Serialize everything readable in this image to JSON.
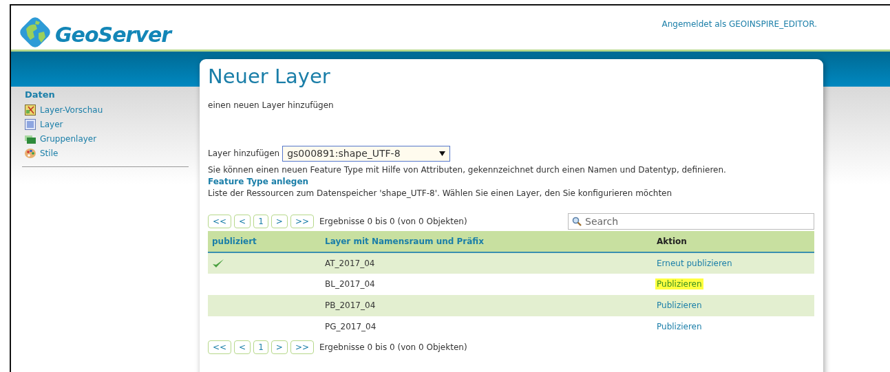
{
  "header": {
    "logo_text": "GeoServer",
    "login_text": "Angemeldet als GEOINSPIRE_EDITOR."
  },
  "sidebar": {
    "heading": "Daten",
    "items": [
      {
        "label": "Layer-Vorschau",
        "kind": "preview"
      },
      {
        "label": "Layer",
        "kind": "layer"
      },
      {
        "label": "Gruppenlayer",
        "kind": "group"
      },
      {
        "label": "Stile",
        "kind": "style"
      }
    ]
  },
  "page": {
    "title": "Neuer Layer",
    "subtitle": "einen neuen Layer hinzufügen",
    "select_label": "Layer hinzufügen",
    "select_value": "gs000891:shape_UTF-8",
    "description": "Sie können einen neuen Feature Type mit Hilfe von Attributen, gekennzeichnet durch einen Namen und Datentyp, definieren.",
    "description_link": "Feature Type anlegen",
    "resources_text": "Liste der Ressourcen zum Datenspeicher 'shape_UTF-8'. Wählen Sie einen Layer, den Sie konfigurieren möchten"
  },
  "pager_top": {
    "buttons": [
      "<<",
      "<",
      "1",
      ">",
      ">>"
    ],
    "results": "Ergebnisse 0 bis 0 (von 0 Objekten)"
  },
  "search": {
    "placeholder": "Search"
  },
  "table": {
    "columns": [
      "publiziert",
      "Layer mit Namensraum und Präfix",
      "Aktion"
    ],
    "rows": [
      {
        "published": true,
        "layer": "AT_2017_04",
        "action": "Erneut publizieren",
        "highlighted": false
      },
      {
        "published": false,
        "layer": "BL_2017_04",
        "action": "Publizieren",
        "highlighted": true
      },
      {
        "published": false,
        "layer": "PB_2017_04",
        "action": "Publizieren",
        "highlighted": false
      },
      {
        "published": false,
        "layer": "PG_2017_04",
        "action": "Publizieren",
        "highlighted": false
      }
    ]
  },
  "pager_bottom": {
    "buttons": [
      "<<",
      "<",
      "1",
      ">",
      ">>"
    ],
    "results": "Ergebnisse 0 bis 0 (von 0 Objekten)"
  }
}
